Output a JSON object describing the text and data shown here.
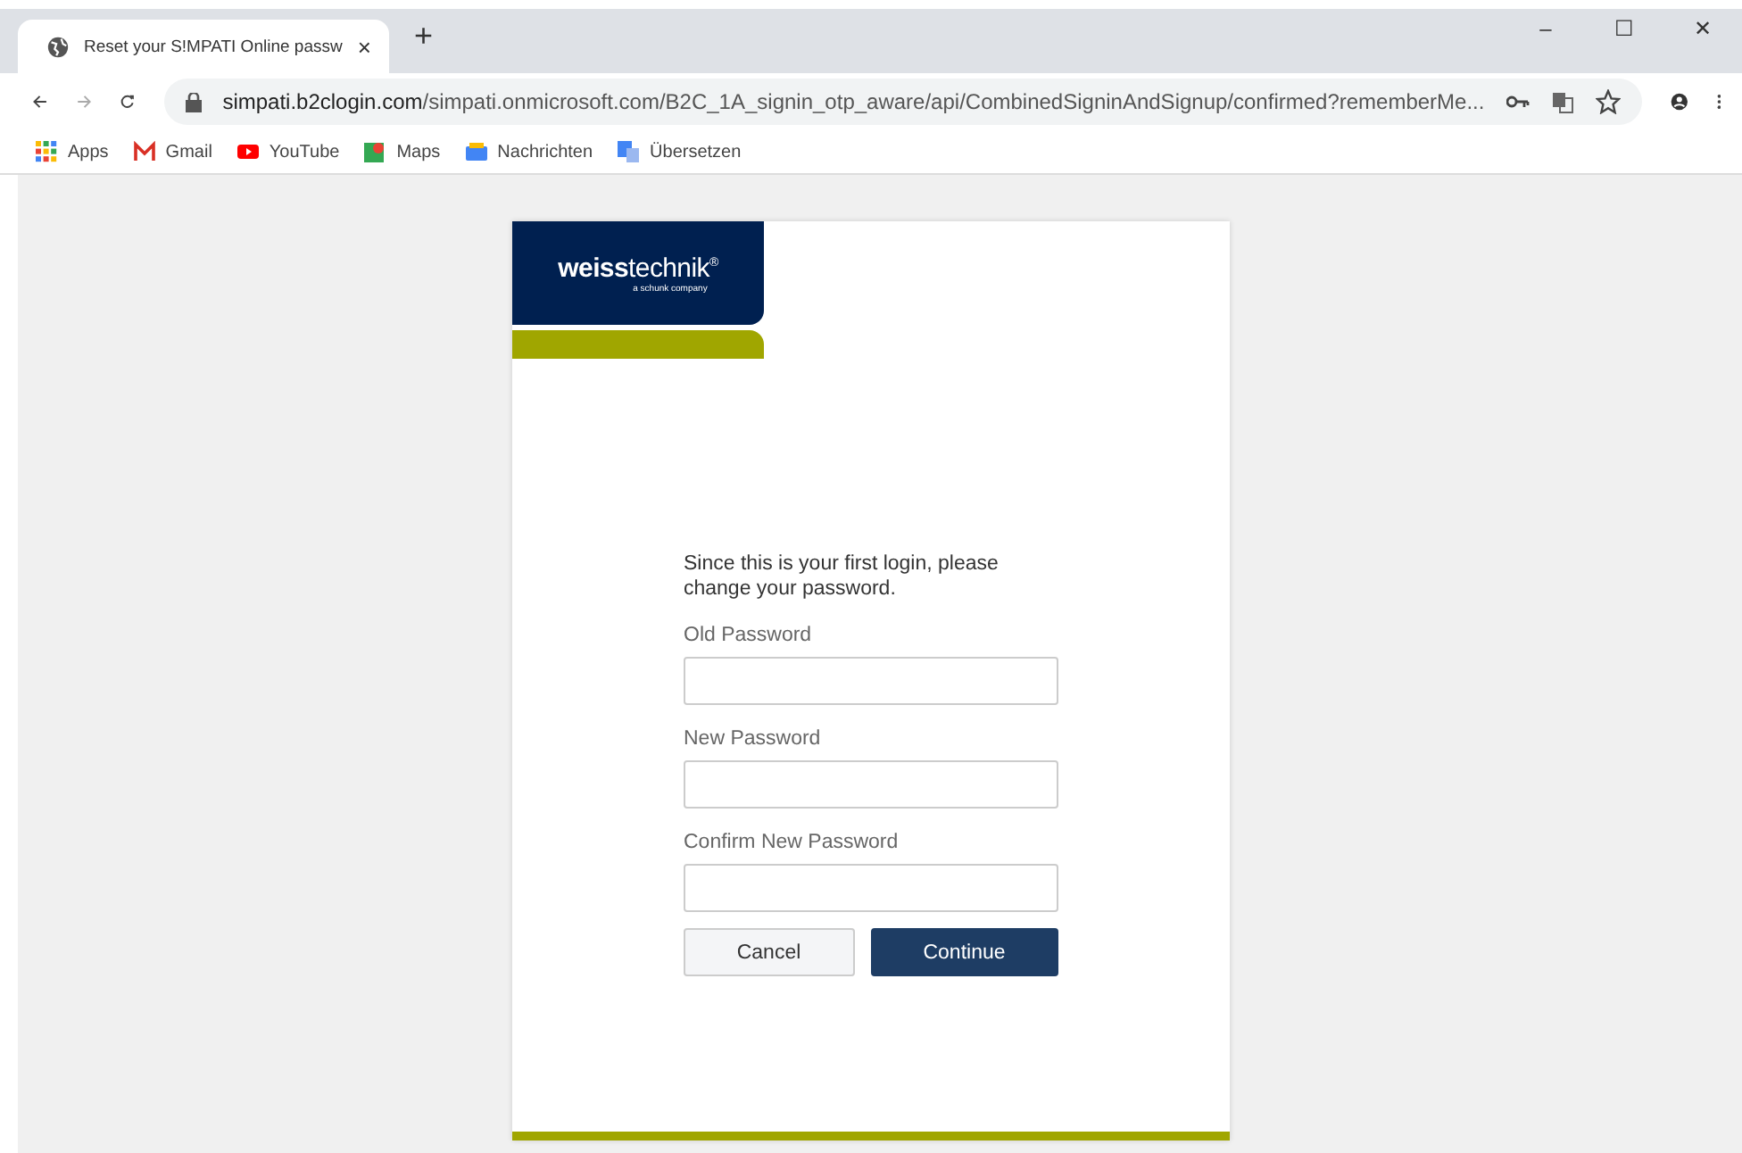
{
  "browser": {
    "tab": {
      "title": "Reset your S!MPATI Online passw",
      "close": "×"
    },
    "new_tab": "+",
    "window_controls": [
      "–",
      "☐",
      "✕"
    ],
    "url": {
      "host": "simpati.b2clogin.com",
      "path": "/simpati.onmicrosoft.com/B2C_1A_signin_otp_aware/api/CombinedSigninAndSignup/confirmed?rememberMe..."
    },
    "bookmarks": [
      {
        "label": "Apps"
      },
      {
        "label": "Gmail"
      },
      {
        "label": "YouTube"
      },
      {
        "label": "Maps"
      },
      {
        "label": "Nachrichten"
      },
      {
        "label": "Übersetzen"
      }
    ]
  },
  "logo": {
    "brand": "**weiss**technik",
    "mark": "®",
    "tagline": "a schunk company"
  },
  "form": {
    "intro": "Since this is your first login, please change your password.",
    "fields": [
      {
        "label": "Old Password"
      },
      {
        "label": "New Password"
      },
      {
        "label": "Confirm New Password"
      }
    ],
    "buttons": [
      {
        "label": "Cancel",
        "kind": "secondary"
      },
      {
        "label": "Continue",
        "kind": "primary"
      }
    ]
  }
}
